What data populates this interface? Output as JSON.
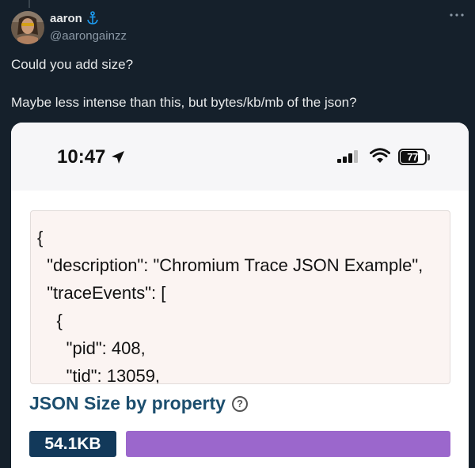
{
  "tweet": {
    "author": {
      "display_name": "aaron",
      "badge_icon": "anchor-icon",
      "handle": "@aarongainzz"
    },
    "more_icon": "more-icon",
    "text_line_1": "Could you add size?",
    "text_line_2": "Maybe less intense than this, but bytes/kb/mb of the json?"
  },
  "screenshot": {
    "status_bar": {
      "time": "10:47",
      "location_icon": "location-arrow-icon",
      "signal_icon": "cellular-signal-icon",
      "wifi_icon": "wifi-icon",
      "battery_level": "77"
    },
    "code_lines": [
      "{",
      "  \"description\": \"Chromium Trace JSON Example\",",
      "  \"traceEvents\": [",
      "    {",
      "      \"pid\": 408,",
      "      \"tid\": 13059,"
    ],
    "size_section": {
      "title": "JSON Size by property",
      "help_icon": "question-circle-icon",
      "help_glyph": "?",
      "size_label": "54.1KB",
      "bar_fraction": 1.0
    }
  },
  "colors": {
    "background": "#15202b",
    "text": "#e7e9ea",
    "muted": "#8b98a5",
    "title_blue": "#1c4e6e",
    "badge_navy": "#12395a",
    "bar_purple": "#9b67cc",
    "code_bg": "#fbf4f2"
  }
}
